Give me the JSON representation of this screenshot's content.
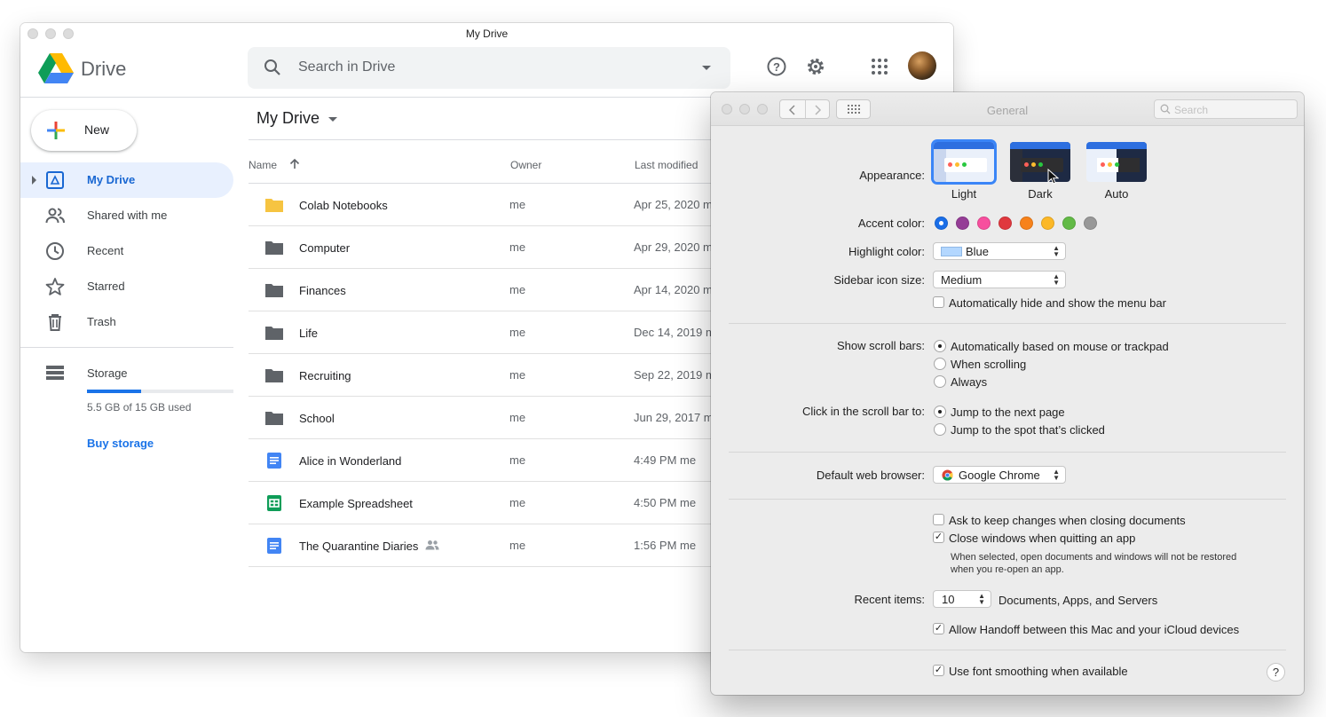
{
  "drive": {
    "window_title": "My Drive",
    "app_name": "Drive",
    "search_placeholder": "Search in Drive",
    "new_label": "New",
    "nav": [
      {
        "label": "My Drive",
        "icon": "my-drive-icon"
      },
      {
        "label": "Shared with me",
        "icon": "shared-icon"
      },
      {
        "label": "Recent",
        "icon": "clock-icon"
      },
      {
        "label": "Starred",
        "icon": "star-icon"
      },
      {
        "label": "Trash",
        "icon": "trash-icon"
      }
    ],
    "storage": {
      "label": "Storage",
      "used_text": "5.5 GB of 15 GB used",
      "used_fraction": 0.37,
      "buy_label": "Buy storage"
    },
    "folder_title": "My Drive",
    "columns": {
      "name": "Name",
      "owner": "Owner",
      "modified": "Last modified"
    },
    "rows": [
      {
        "name": "Colab Notebooks",
        "owner": "me",
        "modified": "Apr 25, 2020  m",
        "type": "folder-yellow"
      },
      {
        "name": "Computer",
        "owner": "me",
        "modified": "Apr 29, 2020  m",
        "type": "folder"
      },
      {
        "name": "Finances",
        "owner": "me",
        "modified": "Apr 14, 2020  m",
        "type": "folder"
      },
      {
        "name": "Life",
        "owner": "me",
        "modified": "Dec 14, 2019  m",
        "type": "folder"
      },
      {
        "name": "Recruiting",
        "owner": "me",
        "modified": "Sep 22, 2019  m",
        "type": "folder"
      },
      {
        "name": "School",
        "owner": "me",
        "modified": "Jun 29, 2017  m",
        "type": "folder"
      },
      {
        "name": "Alice in Wonderland",
        "owner": "me",
        "modified": "4:49 PM  me",
        "type": "doc"
      },
      {
        "name": "Example Spreadsheet",
        "owner": "me",
        "modified": "4:50 PM  me",
        "type": "sheet"
      },
      {
        "name": "The Quarantine Diaries",
        "owner": "me",
        "modified": "1:56 PM  me",
        "type": "doc",
        "shared": true
      }
    ]
  },
  "prefs": {
    "title": "General",
    "search_placeholder": "Search",
    "appearance": {
      "label": "Appearance:",
      "options": [
        "Light",
        "Dark",
        "Auto"
      ],
      "selected": "Light"
    },
    "accent": {
      "label": "Accent color:",
      "colors": [
        "#1a6ee8",
        "#953d96",
        "#f74f9e",
        "#e0383e",
        "#f7821b",
        "#fcb827",
        "#62ba46",
        "#989898"
      ],
      "selected_index": 0
    },
    "highlight": {
      "label": "Highlight color:",
      "value": "Blue",
      "swatch": "#b3d7ff"
    },
    "sidebar_icon": {
      "label": "Sidebar icon size:",
      "value": "Medium"
    },
    "auto_hide_menu": {
      "label": "Automatically hide and show the menu bar",
      "checked": false
    },
    "scroll_bars": {
      "label": "Show scroll bars:",
      "options": [
        "Automatically based on mouse or trackpad",
        "When scrolling",
        "Always"
      ],
      "selected_index": 0
    },
    "click_scroll": {
      "label": "Click in the scroll bar to:",
      "options": [
        "Jump to the next page",
        "Jump to the spot that’s clicked"
      ],
      "selected_index": 0
    },
    "browser": {
      "label": "Default web browser:",
      "value": "Google Chrome"
    },
    "ask_keep": {
      "label": "Ask to keep changes when closing documents",
      "checked": false
    },
    "close_windows": {
      "label": "Close windows when quitting an app",
      "checked": true
    },
    "close_note": [
      "When selected, open documents and windows will not be restored",
      "when you re-open an app."
    ],
    "recent": {
      "label": "Recent items:",
      "value": "10",
      "suffix": "Documents, Apps, and Servers"
    },
    "handoff": {
      "label": "Allow Handoff between this Mac and your iCloud devices",
      "checked": true
    },
    "font_smoothing": {
      "label": "Use font smoothing when available",
      "checked": true
    },
    "help_label": "?"
  }
}
